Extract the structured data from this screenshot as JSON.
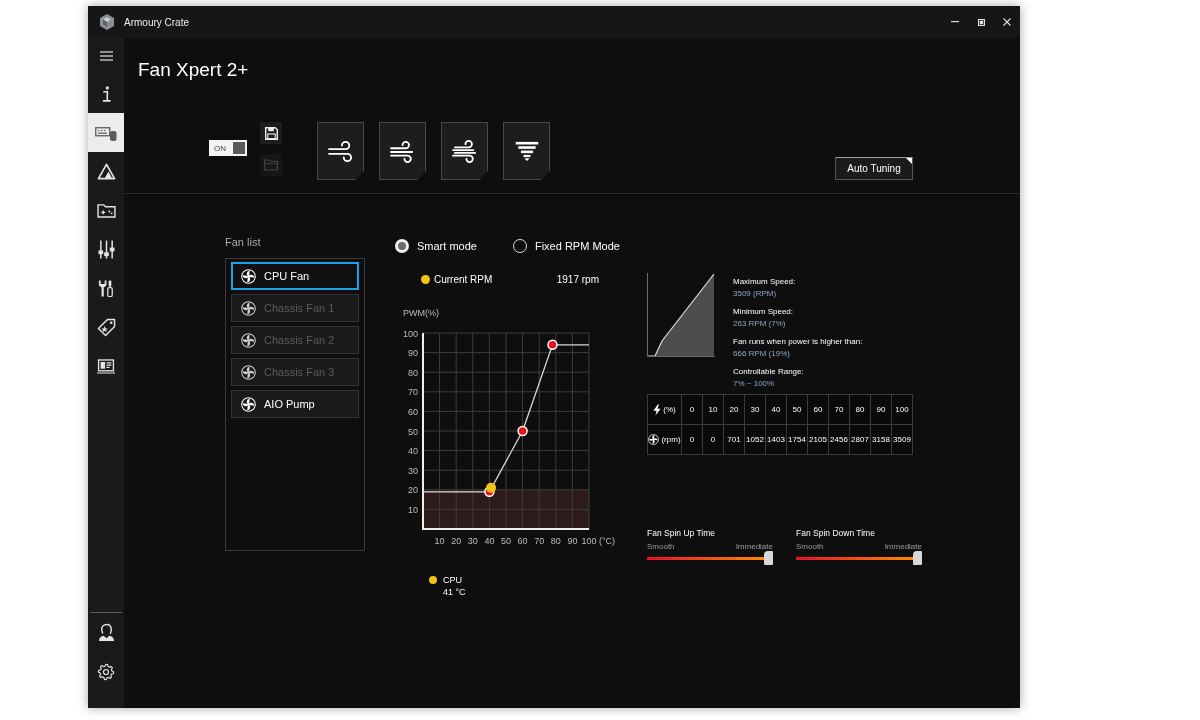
{
  "window": {
    "title": "Armoury Crate"
  },
  "sidebar": {
    "items": [
      {
        "kind": "info",
        "selected": false
      },
      {
        "kind": "keyboard",
        "selected": true
      },
      {
        "kind": "triangle",
        "selected": false
      },
      {
        "kind": "folder",
        "selected": false
      },
      {
        "kind": "sliders",
        "selected": false
      },
      {
        "kind": "tools",
        "selected": false
      },
      {
        "kind": "tag",
        "selected": false
      },
      {
        "kind": "news",
        "selected": false
      }
    ],
    "bottom_items": [
      {
        "kind": "user"
      },
      {
        "kind": "settings"
      }
    ]
  },
  "page": {
    "title": "Fan Xpert 2+"
  },
  "toggle": {
    "label": "ON",
    "on": true
  },
  "file_buttons": [
    {
      "kind": "save",
      "disabled": false
    },
    {
      "kind": "open",
      "disabled": true
    }
  ],
  "profiles": [
    {
      "kind": "light"
    },
    {
      "kind": "medium"
    },
    {
      "kind": "strong"
    },
    {
      "kind": "tornado"
    }
  ],
  "auto_tuning": {
    "label": "Auto Tuning"
  },
  "fan_list": {
    "title": "Fan list",
    "items": [
      {
        "label": "CPU Fan",
        "selected": true,
        "disabled": false
      },
      {
        "label": "Chassis Fan 1",
        "selected": false,
        "disabled": true
      },
      {
        "label": "Chassis Fan 2",
        "selected": false,
        "disabled": true
      },
      {
        "label": "Chassis Fan 3",
        "selected": false,
        "disabled": true
      },
      {
        "label": "AIO Pump",
        "selected": false,
        "disabled": false
      }
    ]
  },
  "modes": [
    {
      "label": "Smart mode",
      "selected": true
    },
    {
      "label": "Fixed RPM Mode",
      "selected": false
    }
  ],
  "current_rpm": {
    "label": "Current RPM",
    "value": "1917 rpm"
  },
  "fan_curve": {
    "chart_data": {
      "type": "line",
      "xlabel": "(°C)",
      "ylabel": "PWM(%)",
      "x": [
        0,
        40,
        41,
        60,
        78,
        100
      ],
      "series": [
        {
          "color": "#d9d9d9",
          "marker": "circle",
          "values": [
            19,
            19,
            null,
            50,
            94,
            94
          ]
        },
        {
          "color": "#f3c316",
          "marker": "circle",
          "values": [
            null,
            null,
            21,
            null,
            null,
            null
          ]
        }
      ],
      "xlim": [
        0,
        100
      ],
      "ylim": [
        0,
        100
      ],
      "xticks": [
        10,
        20,
        30,
        40,
        50,
        60,
        70,
        80,
        90,
        100
      ],
      "yticks": [
        10,
        20,
        30,
        40,
        50,
        60,
        70,
        80,
        90,
        100
      ],
      "grid": true,
      "bands": [
        {
          "axis": "y",
          "from": 0,
          "to": 20,
          "color": "#2e1b1c"
        }
      ]
    }
  },
  "sensor": {
    "label": "CPU",
    "value": "41 °C"
  },
  "speed_info": [
    {
      "label": "Maximum Speed:",
      "value": "3509 (RPM)"
    },
    {
      "label": "Minimum Speed:",
      "value": "263 RPM (7%)"
    },
    {
      "label": "Fan runs when power is higher than:",
      "value": "666 RPM (19%)"
    },
    {
      "label": "Controllable Range:",
      "value": "7% ~ 100%"
    }
  ],
  "speed_table": {
    "rows": [
      {
        "kind": "power",
        "unit": "(%)",
        "cells": [
          "0",
          "10",
          "20",
          "30",
          "40",
          "50",
          "60",
          "70",
          "80",
          "90",
          "100"
        ]
      },
      {
        "kind": "fan",
        "unit": "(rpm)",
        "cells": [
          "0",
          "0",
          "701",
          "1052",
          "1403",
          "1754",
          "2105",
          "2456",
          "2807",
          "3158",
          "3509"
        ]
      }
    ]
  },
  "sliders": [
    {
      "title": "Fan Spin Up Time",
      "min_label": "Smooth",
      "max_label": "Immediate",
      "level": 1
    },
    {
      "title": "Fan Spin Down Time",
      "min_label": "Smooth",
      "max_label": "Immediate",
      "level": 1
    }
  ]
}
